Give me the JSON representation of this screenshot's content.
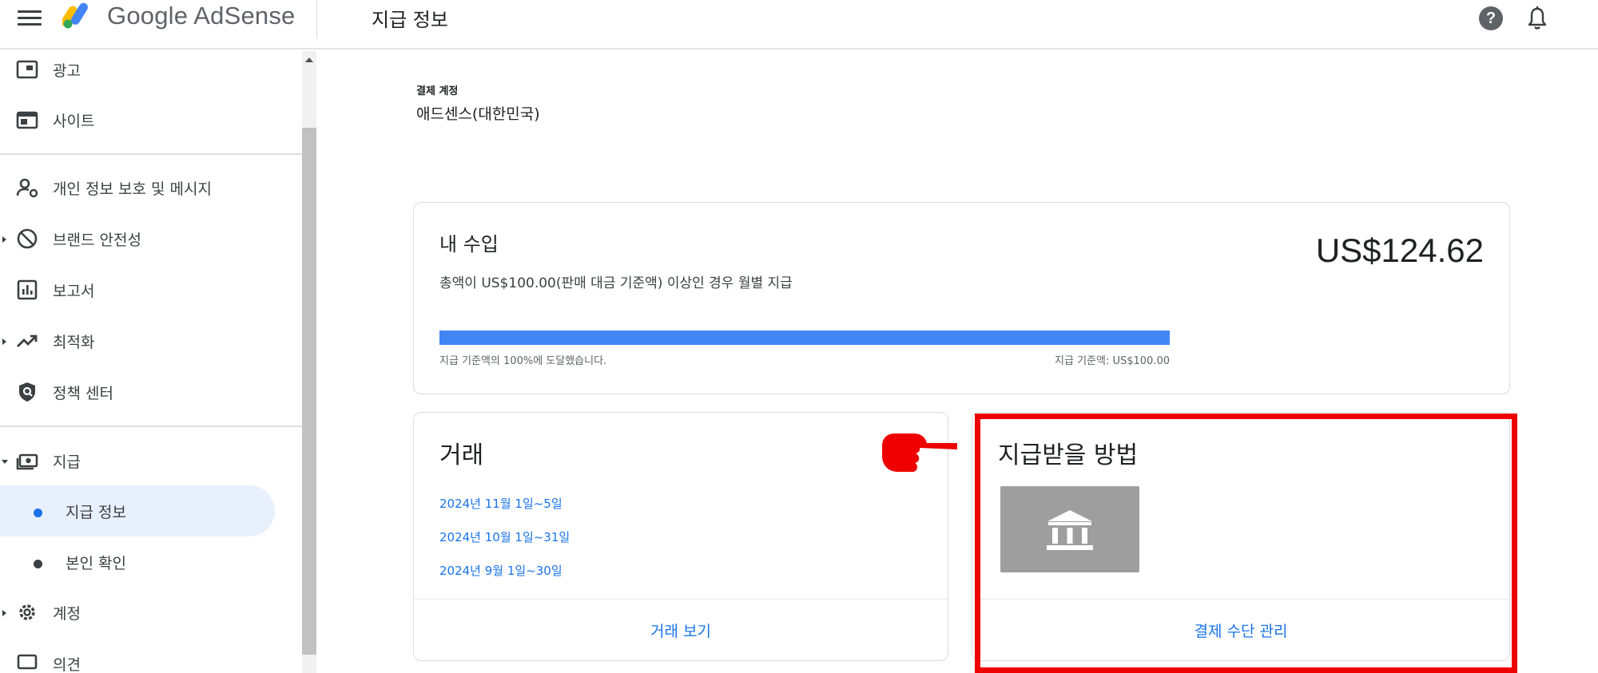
{
  "header": {
    "logo_text": "Google AdSense",
    "page_title": "지급 정보",
    "help_glyph": "?"
  },
  "sidebar": {
    "items": [
      {
        "label": "광고",
        "icon": "ad-unit-icon"
      },
      {
        "label": "사이트",
        "icon": "site-icon"
      },
      {
        "label": "개인 정보 보호 및 메시지",
        "icon": "privacy-icon"
      },
      {
        "label": "브랜드 안전성",
        "icon": "block-icon"
      },
      {
        "label": "보고서",
        "icon": "bar-chart-icon"
      },
      {
        "label": "최적화",
        "icon": "trending-up-icon"
      },
      {
        "label": "정책 센터",
        "icon": "shield-icon"
      },
      {
        "label": "지급",
        "icon": "payments-icon"
      },
      {
        "label": "계정",
        "icon": "gear-icon"
      },
      {
        "label": "의견",
        "icon": "feedback-icon"
      }
    ],
    "payments_sub": [
      {
        "label": "지급 정보",
        "active": true
      },
      {
        "label": "본인 확인",
        "active": false
      }
    ]
  },
  "account": {
    "label": "결제 계정",
    "value": "애드센스(대한민국)"
  },
  "earnings": {
    "title": "내 수입",
    "description": "총액이 US$100.00(판매 대금 기준액) 이상인 경우 월별 지급",
    "amount": "US$124.62",
    "progress_percent": 100,
    "progress_left": "지급 기준액의 100%에 도달했습니다.",
    "progress_right": "지급 기준액: US$100.00"
  },
  "transactions": {
    "title": "거래",
    "links": [
      "2024년 11월 1일~5일",
      "2024년 10월 1일~31일",
      "2024년 9월 1일~30일"
    ],
    "footer": "거래 보기"
  },
  "payment_method": {
    "title": "지급받을 방법",
    "icon": "bank-icon",
    "footer": "결제 수단 관리"
  },
  "colors": {
    "accent": "#1a73e8",
    "progress": "#4285f4",
    "highlight": "#ee0000",
    "active_bg": "#e8f0fe"
  }
}
